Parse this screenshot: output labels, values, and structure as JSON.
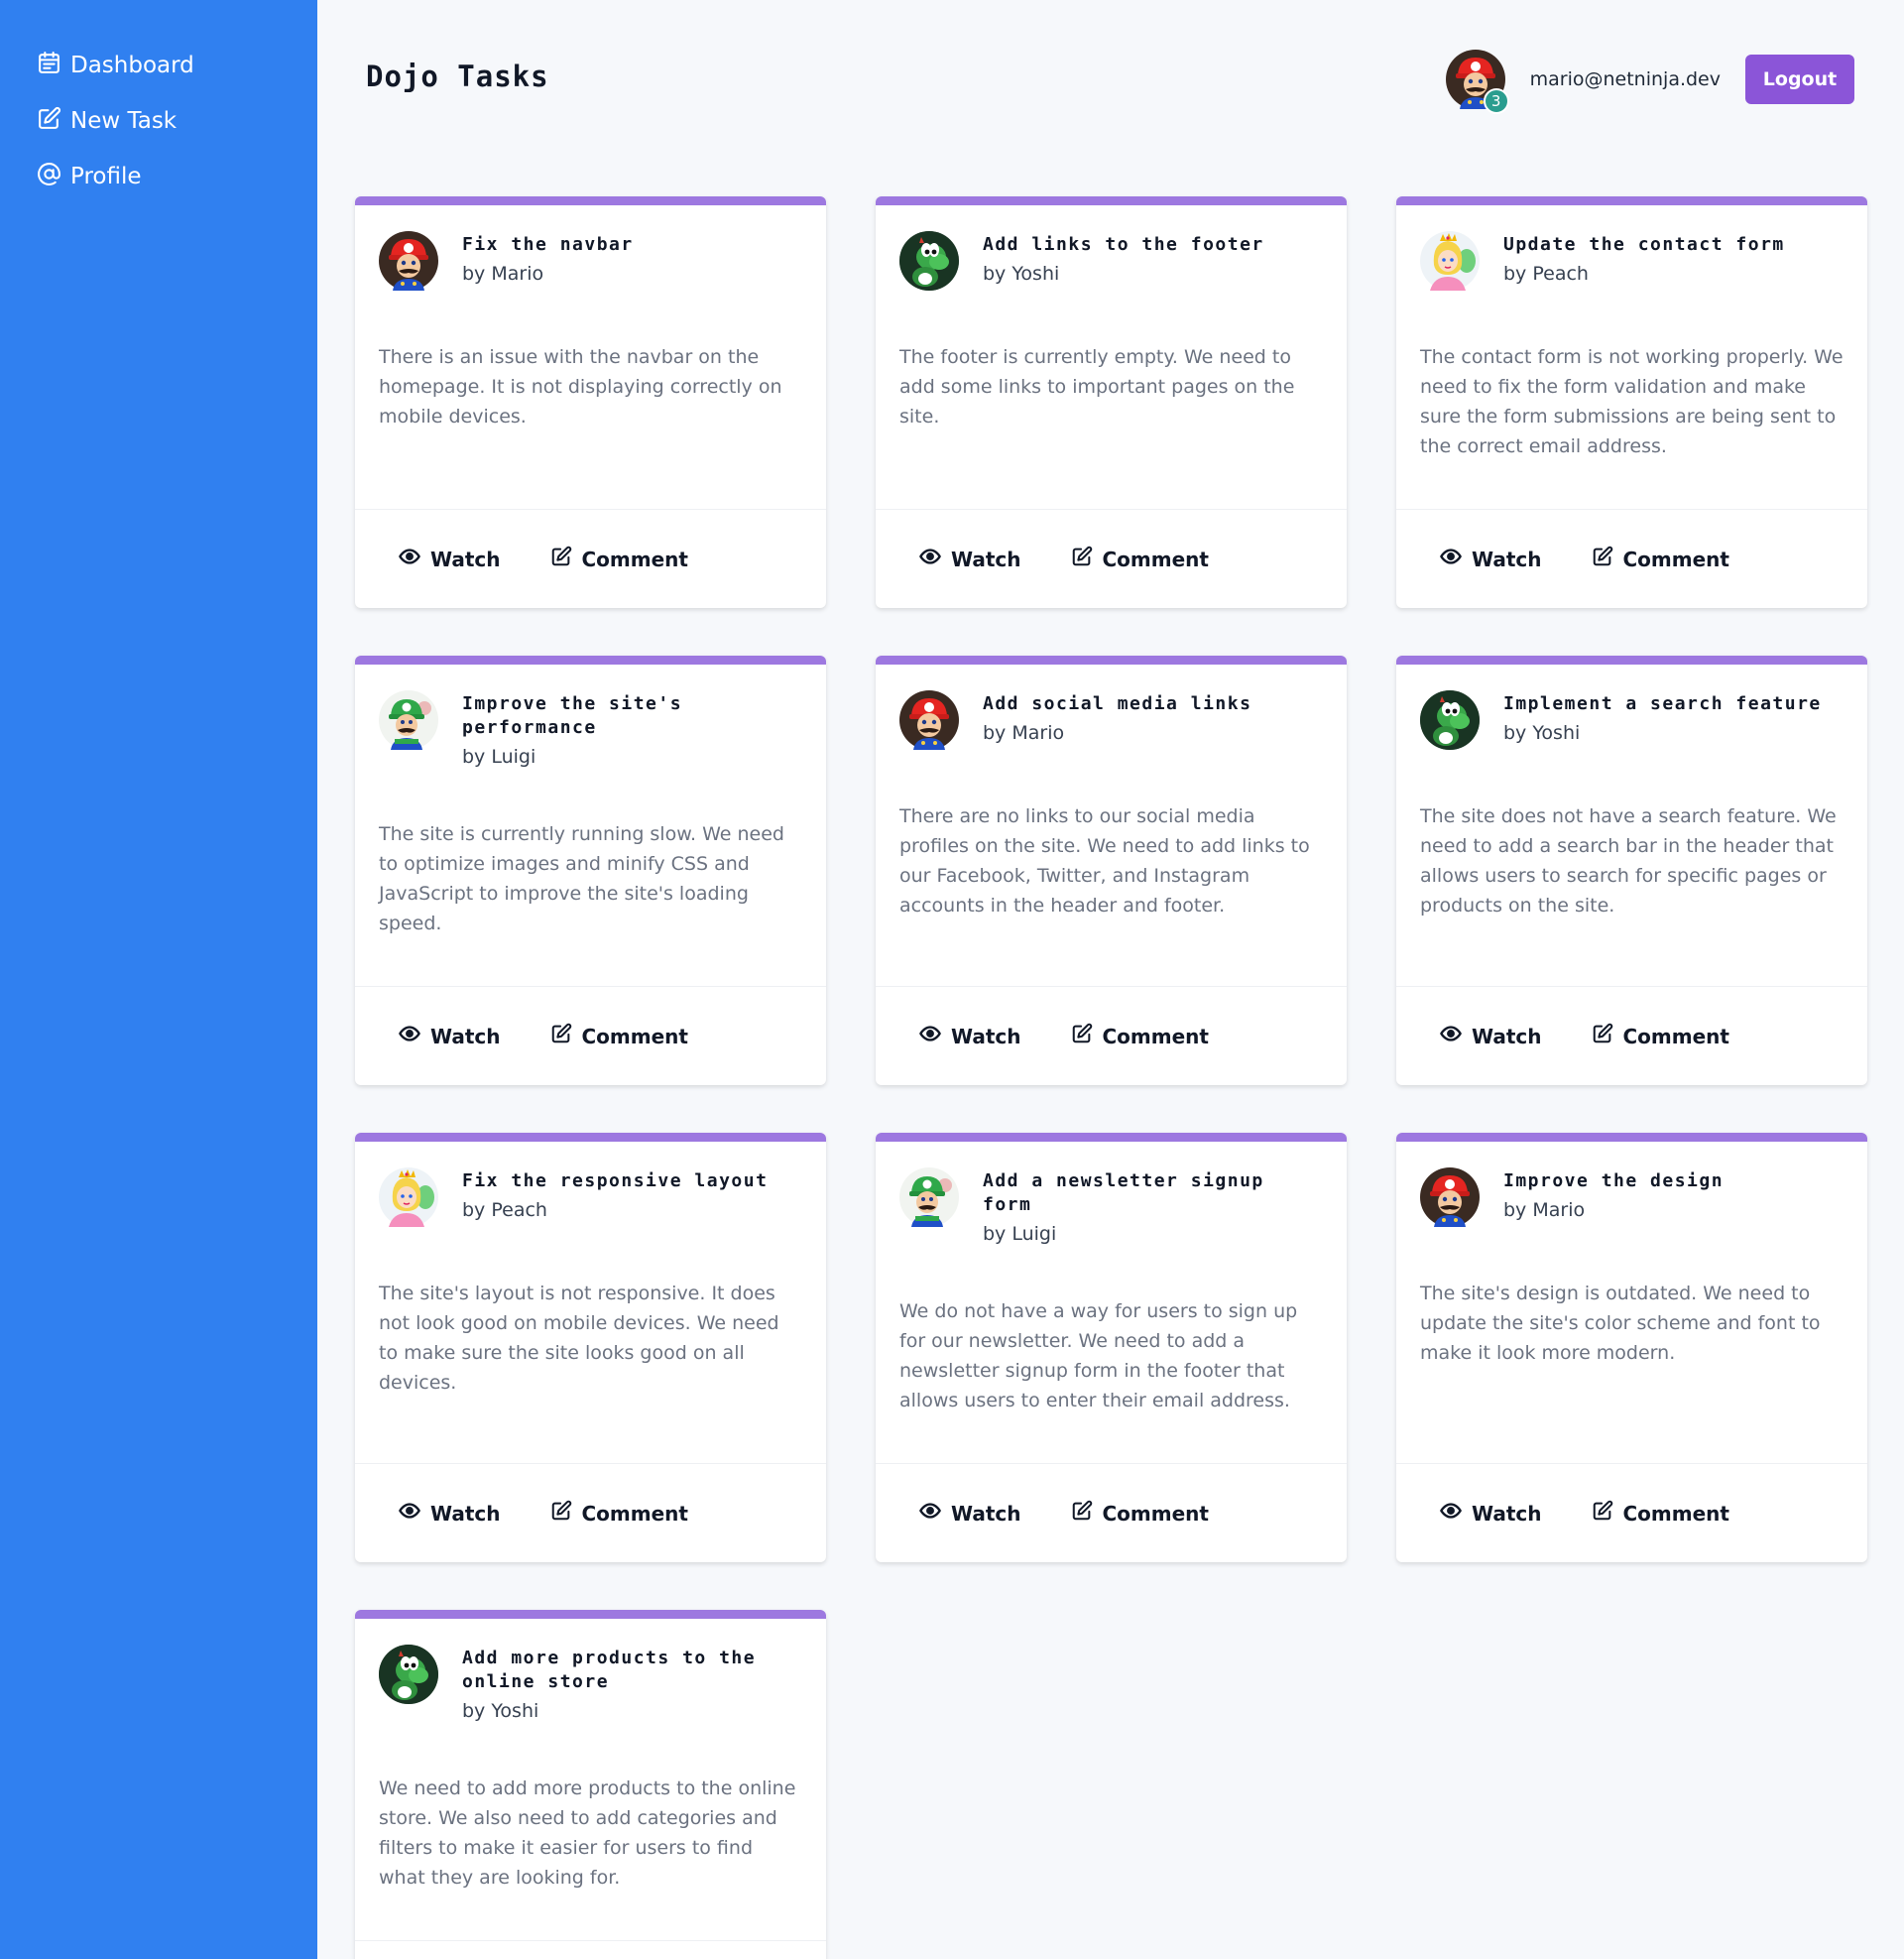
{
  "sidebar": {
    "items": [
      {
        "label": "Dashboard",
        "icon": "calendar-icon"
      },
      {
        "label": "New Task",
        "icon": "edit-icon"
      },
      {
        "label": "Profile",
        "icon": "at-icon"
      }
    ]
  },
  "header": {
    "title": "Dojo Tasks",
    "notification_count": "3",
    "user_email": "mario@netninja.dev",
    "logout_label": "Logout"
  },
  "colors": {
    "sidebar": "#3080f0",
    "accent": "#8b55d8",
    "card_border": "#9d78e0",
    "badge": "#2a9d8f"
  },
  "actions": {
    "watch_label": "Watch",
    "comment_label": "Comment"
  },
  "tasks": [
    {
      "title": "Fix the navbar",
      "author": "by Mario",
      "avatar": "mario",
      "description": "There is an issue with the navbar on the homepage. It is not displaying correctly on mobile devices."
    },
    {
      "title": "Add links to the footer",
      "author": "by Yoshi",
      "avatar": "yoshi",
      "description": "The footer is currently empty. We need to add some links to important pages on the site."
    },
    {
      "title": "Update the contact form",
      "author": "by Peach",
      "avatar": "peach",
      "description": "The contact form is not working properly. We need to fix the form validation and make sure the form submissions are being sent to the correct email address."
    },
    {
      "title": "Improve the site's performance",
      "author": "by Luigi",
      "avatar": "luigi",
      "description": "The site is currently running slow. We need to optimize images and minify CSS and JavaScript to improve the site's loading speed."
    },
    {
      "title": "Add social media links",
      "author": "by Mario",
      "avatar": "mario",
      "description": "There are no links to our social media profiles on the site. We need to add links to our Facebook, Twitter, and Instagram accounts in the header and footer."
    },
    {
      "title": "Implement a search feature",
      "author": "by Yoshi",
      "avatar": "yoshi",
      "description": "The site does not have a search feature. We need to add a search bar in the header that allows users to search for specific pages or products on the site."
    },
    {
      "title": "Fix the responsive layout",
      "author": "by Peach",
      "avatar": "peach",
      "description": "The site's layout is not responsive. It does not look good on mobile devices. We need to make sure the site looks good on all devices."
    },
    {
      "title": "Add a newsletter signup form",
      "author": "by Luigi",
      "avatar": "luigi",
      "description": "We do not have a way for users to sign up for our newsletter. We need to add a newsletter signup form in the footer that allows users to enter their email address."
    },
    {
      "title": "Improve the design",
      "author": "by Mario",
      "avatar": "mario",
      "description": "The site's design is outdated. We need to update the site's color scheme and font to make it look more modern."
    },
    {
      "title": "Add more products to the online store",
      "author": "by Yoshi",
      "avatar": "yoshi",
      "description": "We need to add more products to the online store. We also need to add categories and filters to make it easier for users to find what they are looking for."
    }
  ]
}
